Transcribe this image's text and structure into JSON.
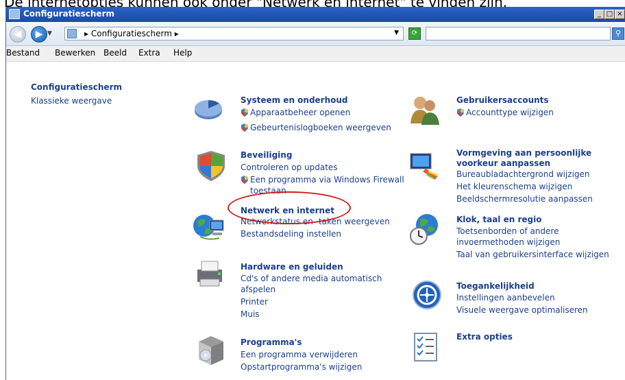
{
  "caption": "De internetopties kunnen ook onder \"Netwerk en internet\" te vinden zijn.",
  "window": {
    "title": "Configuratiescherm",
    "controls": [
      "_",
      "□",
      "×"
    ]
  },
  "navbar": {
    "address": "Configuratiescherm",
    "search_placeholder": ""
  },
  "menu": [
    "Bestand",
    "Bewerken",
    "Beeld",
    "Extra",
    "Help"
  ],
  "sidebar": {
    "title": "Configuratiescherm",
    "link": "Klassieke weergave"
  },
  "categories": [
    {
      "id": "system",
      "title": "Systeem en onderhoud",
      "links": [
        "Apparaatbeheer openen",
        "Gebeurtenislogboeken weergeven"
      ],
      "icon": "pie-chart-icon"
    },
    {
      "id": "security",
      "title": "Beveiliging",
      "links": [
        "Controleren op updates",
        "Een programma via Windows Firewall",
        "toestaan"
      ],
      "icon": "security-shield-icon"
    },
    {
      "id": "network",
      "title": "Netwerk en internet",
      "links": [
        "Netwerkstatus en -taken weergeven",
        "Bestandsdeling instellen"
      ],
      "icon": "network-globe-icon"
    },
    {
      "id": "hardware",
      "title": "Hardware en geluiden",
      "links": [
        "Cd's of andere media automatisch",
        "afspelen",
        "Printer",
        "Muis"
      ],
      "icon": "printer-icon"
    },
    {
      "id": "programs",
      "title": "Programma's",
      "links": [
        "Een programma verwijderen",
        "Opstartprogramma's wijzigen"
      ],
      "icon": "programs-box-icon"
    },
    {
      "id": "users",
      "title": "Gebruikersaccounts",
      "links": [
        "Accounttype wijzigen"
      ],
      "icon": "users-icon"
    },
    {
      "id": "appearance",
      "title": "Vormgeving aan persoonlijke",
      "title2": "voorkeur aanpassen",
      "links": [
        "Bureaubladachtergrond wijzigen",
        "Het kleurenschema wijzigen",
        "Beeldschermresolutie aanpassen"
      ],
      "icon": "display-brush-icon"
    },
    {
      "id": "clock",
      "title": "Klok, taal en regio",
      "links": [
        "Toetsenborden of andere",
        "invoermethoden wijzigen",
        "Taal van gebruikersinterface wijzigen"
      ],
      "icon": "globe-clock-icon"
    },
    {
      "id": "access",
      "title": "Toegankelijkheid",
      "links": [
        "Instellingen aanbevelen",
        "Visuele weergave optimaliseren"
      ],
      "icon": "accessibility-icon"
    },
    {
      "id": "extra",
      "title": "Extra opties",
      "links": [],
      "icon": "checklist-icon"
    }
  ],
  "colors": {
    "link": "#1c3f8c",
    "titlebar": "#2a63c8",
    "highlight": "#cc1e1e"
  }
}
